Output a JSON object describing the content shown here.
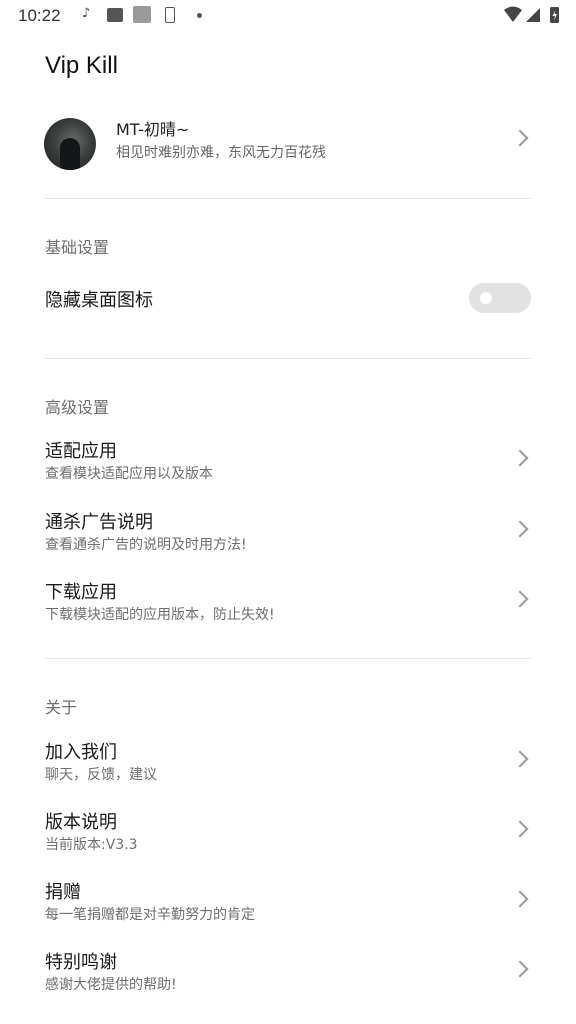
{
  "status_bar": {
    "time": "10:22",
    "icons": [
      "music-note-icon",
      "image-icon",
      "app-square-icon",
      "phone-outline-icon",
      "dot-icon",
      "wifi-icon",
      "signal-icon",
      "battery-charging-icon"
    ]
  },
  "app": {
    "title": "Vip Kill"
  },
  "profile": {
    "name": "MT-初晴~",
    "signature": "相见时难别亦难，东风无力百花残"
  },
  "sections": {
    "basic": {
      "title": "基础设置",
      "hide_icon": {
        "label": "隐藏桌面图标",
        "enabled": false
      }
    },
    "advanced": {
      "title": "高级设置",
      "items": [
        {
          "title": "适配应用",
          "subtitle": "查看模块适配应用以及版本"
        },
        {
          "title": "通杀广告说明",
          "subtitle": "查看通杀广告的说明及时用方法!"
        },
        {
          "title": "下载应用",
          "subtitle": "下载模块适配的应用版本，防止失效!"
        }
      ]
    },
    "about": {
      "title": "关于",
      "items": [
        {
          "title": "加入我们",
          "subtitle": "聊天，反馈，建议"
        },
        {
          "title": "版本说明",
          "subtitle": "当前版本:V3.3"
        },
        {
          "title": "捐赠",
          "subtitle": "每一笔捐赠都是对辛勤努力的肯定"
        },
        {
          "title": "特别鸣谢",
          "subtitle": "感谢大佬提供的帮助!"
        }
      ]
    }
  },
  "colors": {
    "background": "#ffffff",
    "divider": "#e6e6e6",
    "secondary_text": "#6e6e6e",
    "toggle_track": "#e2e2e2"
  }
}
